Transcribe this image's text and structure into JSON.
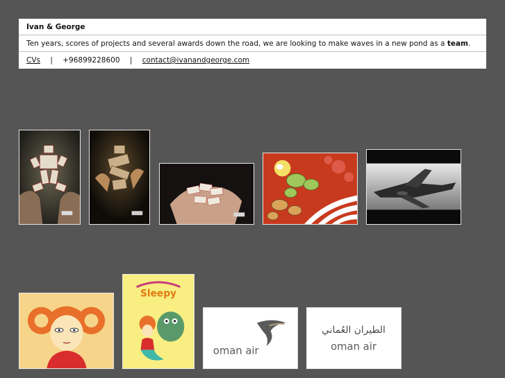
{
  "header": {
    "title": "Ivan & George",
    "tagline_pre": "Ten years, scores of projects and several awards down the road, we are looking to make waves in a new pond as a ",
    "tagline_bold": "team",
    "tagline_post": ".",
    "links": {
      "cvs": "CVs",
      "separator": "|",
      "phone": "+96899228600",
      "email": "contact@ivanandgeorge.com"
    }
  },
  "gallery": {
    "row1": [
      {
        "name": "card-figure-photo"
      },
      {
        "name": "card-figure-dark-photo"
      },
      {
        "name": "hands-holding-cards-photo"
      },
      {
        "name": "cartoon-race-illustration"
      },
      {
        "name": "jet-plane-photo"
      }
    ],
    "row2": [
      {
        "name": "redhead-girl-illustration"
      },
      {
        "name": "poster-illustration",
        "poster_text": "Sleepy"
      },
      {
        "name": "oman-air-logo-english",
        "brand": "oman air"
      },
      {
        "name": "oman-air-logo-arabic",
        "brand": "oman air",
        "brand_arabic": "الطيران العُماني"
      }
    ]
  },
  "colors": {
    "background": "#555555",
    "header_bg": "#ffffff",
    "oman_logo": "#5a5a5a"
  }
}
